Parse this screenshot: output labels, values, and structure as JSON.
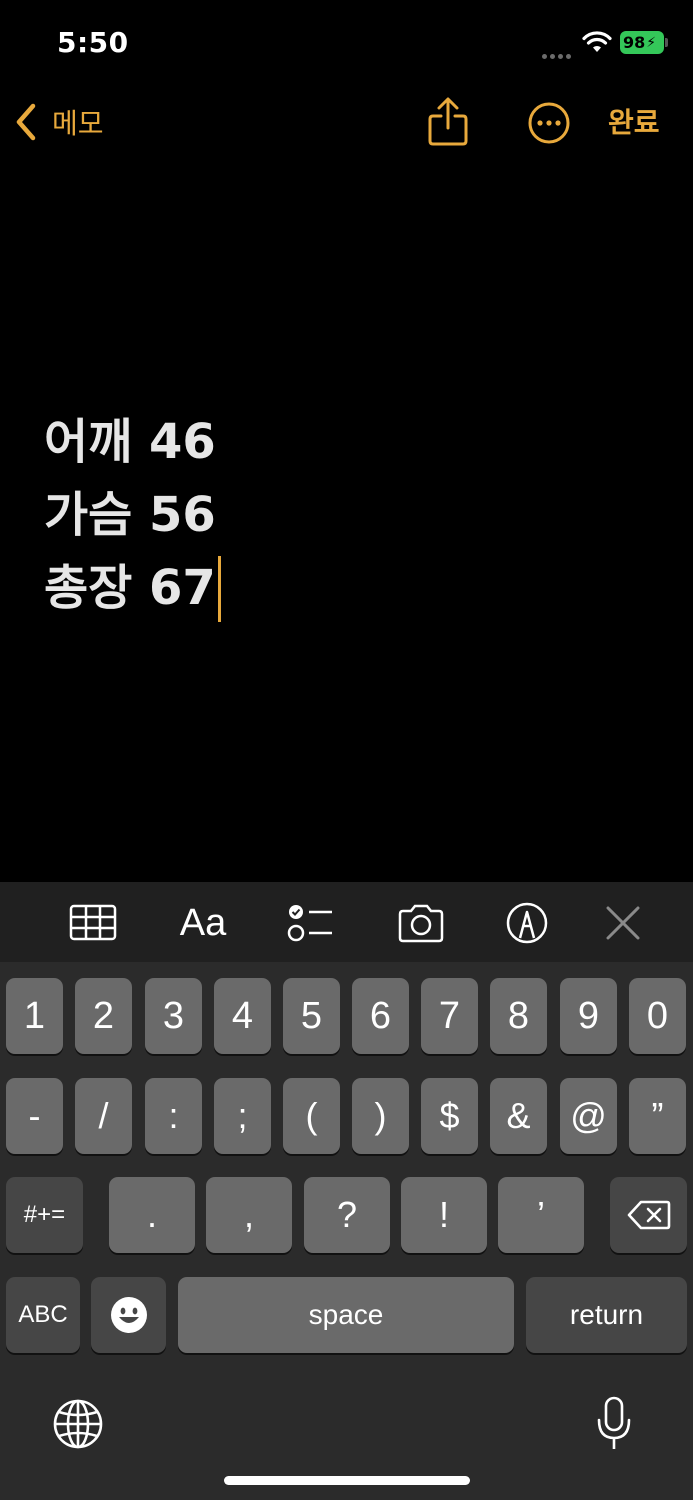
{
  "status_bar": {
    "time": "5:50",
    "battery": "98"
  },
  "nav": {
    "back_label": "메모",
    "done_label": "완료"
  },
  "note": {
    "lines": [
      "어깨 46",
      "가슴 56",
      "총장 67"
    ]
  },
  "toolbar": {
    "format_label": "Aa"
  },
  "keyboard": {
    "row1": [
      "1",
      "2",
      "3",
      "4",
      "5",
      "6",
      "7",
      "8",
      "9",
      "0"
    ],
    "row2": [
      "-",
      "/",
      ":",
      ";",
      "(",
      ")",
      "$",
      "&",
      "@",
      "”"
    ],
    "row3_shift": "#+=",
    "row3": [
      ".",
      ",",
      "?",
      "!",
      "’"
    ],
    "abc": "ABC",
    "space": "space",
    "return": "return"
  },
  "colors": {
    "accent": "#e8a93c",
    "battery": "#34c759"
  }
}
